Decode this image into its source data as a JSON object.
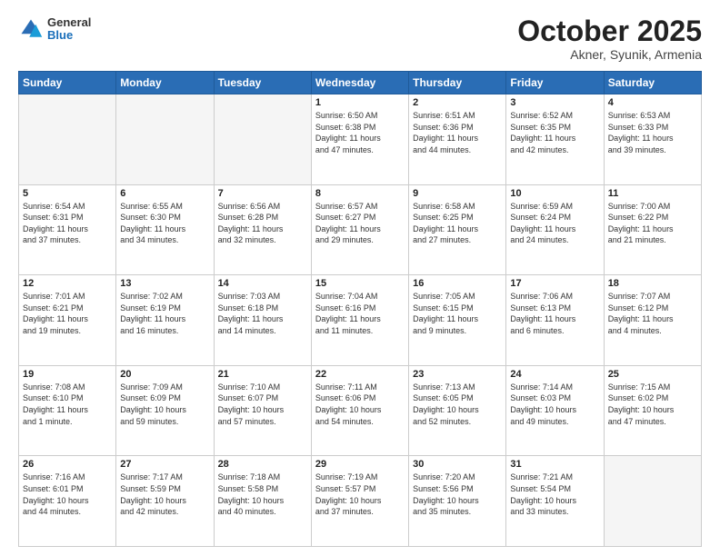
{
  "header": {
    "logo": {
      "general": "General",
      "blue": "Blue"
    },
    "title": "October 2025",
    "location": "Akner, Syunik, Armenia"
  },
  "weekdays": [
    "Sunday",
    "Monday",
    "Tuesday",
    "Wednesday",
    "Thursday",
    "Friday",
    "Saturday"
  ],
  "weeks": [
    [
      {
        "day": "",
        "info": ""
      },
      {
        "day": "",
        "info": ""
      },
      {
        "day": "",
        "info": ""
      },
      {
        "day": "1",
        "info": "Sunrise: 6:50 AM\nSunset: 6:38 PM\nDaylight: 11 hours\nand 47 minutes."
      },
      {
        "day": "2",
        "info": "Sunrise: 6:51 AM\nSunset: 6:36 PM\nDaylight: 11 hours\nand 44 minutes."
      },
      {
        "day": "3",
        "info": "Sunrise: 6:52 AM\nSunset: 6:35 PM\nDaylight: 11 hours\nand 42 minutes."
      },
      {
        "day": "4",
        "info": "Sunrise: 6:53 AM\nSunset: 6:33 PM\nDaylight: 11 hours\nand 39 minutes."
      }
    ],
    [
      {
        "day": "5",
        "info": "Sunrise: 6:54 AM\nSunset: 6:31 PM\nDaylight: 11 hours\nand 37 minutes."
      },
      {
        "day": "6",
        "info": "Sunrise: 6:55 AM\nSunset: 6:30 PM\nDaylight: 11 hours\nand 34 minutes."
      },
      {
        "day": "7",
        "info": "Sunrise: 6:56 AM\nSunset: 6:28 PM\nDaylight: 11 hours\nand 32 minutes."
      },
      {
        "day": "8",
        "info": "Sunrise: 6:57 AM\nSunset: 6:27 PM\nDaylight: 11 hours\nand 29 minutes."
      },
      {
        "day": "9",
        "info": "Sunrise: 6:58 AM\nSunset: 6:25 PM\nDaylight: 11 hours\nand 27 minutes."
      },
      {
        "day": "10",
        "info": "Sunrise: 6:59 AM\nSunset: 6:24 PM\nDaylight: 11 hours\nand 24 minutes."
      },
      {
        "day": "11",
        "info": "Sunrise: 7:00 AM\nSunset: 6:22 PM\nDaylight: 11 hours\nand 21 minutes."
      }
    ],
    [
      {
        "day": "12",
        "info": "Sunrise: 7:01 AM\nSunset: 6:21 PM\nDaylight: 11 hours\nand 19 minutes."
      },
      {
        "day": "13",
        "info": "Sunrise: 7:02 AM\nSunset: 6:19 PM\nDaylight: 11 hours\nand 16 minutes."
      },
      {
        "day": "14",
        "info": "Sunrise: 7:03 AM\nSunset: 6:18 PM\nDaylight: 11 hours\nand 14 minutes."
      },
      {
        "day": "15",
        "info": "Sunrise: 7:04 AM\nSunset: 6:16 PM\nDaylight: 11 hours\nand 11 minutes."
      },
      {
        "day": "16",
        "info": "Sunrise: 7:05 AM\nSunset: 6:15 PM\nDaylight: 11 hours\nand 9 minutes."
      },
      {
        "day": "17",
        "info": "Sunrise: 7:06 AM\nSunset: 6:13 PM\nDaylight: 11 hours\nand 6 minutes."
      },
      {
        "day": "18",
        "info": "Sunrise: 7:07 AM\nSunset: 6:12 PM\nDaylight: 11 hours\nand 4 minutes."
      }
    ],
    [
      {
        "day": "19",
        "info": "Sunrise: 7:08 AM\nSunset: 6:10 PM\nDaylight: 11 hours\nand 1 minute."
      },
      {
        "day": "20",
        "info": "Sunrise: 7:09 AM\nSunset: 6:09 PM\nDaylight: 10 hours\nand 59 minutes."
      },
      {
        "day": "21",
        "info": "Sunrise: 7:10 AM\nSunset: 6:07 PM\nDaylight: 10 hours\nand 57 minutes."
      },
      {
        "day": "22",
        "info": "Sunrise: 7:11 AM\nSunset: 6:06 PM\nDaylight: 10 hours\nand 54 minutes."
      },
      {
        "day": "23",
        "info": "Sunrise: 7:13 AM\nSunset: 6:05 PM\nDaylight: 10 hours\nand 52 minutes."
      },
      {
        "day": "24",
        "info": "Sunrise: 7:14 AM\nSunset: 6:03 PM\nDaylight: 10 hours\nand 49 minutes."
      },
      {
        "day": "25",
        "info": "Sunrise: 7:15 AM\nSunset: 6:02 PM\nDaylight: 10 hours\nand 47 minutes."
      }
    ],
    [
      {
        "day": "26",
        "info": "Sunrise: 7:16 AM\nSunset: 6:01 PM\nDaylight: 10 hours\nand 44 minutes."
      },
      {
        "day": "27",
        "info": "Sunrise: 7:17 AM\nSunset: 5:59 PM\nDaylight: 10 hours\nand 42 minutes."
      },
      {
        "day": "28",
        "info": "Sunrise: 7:18 AM\nSunset: 5:58 PM\nDaylight: 10 hours\nand 40 minutes."
      },
      {
        "day": "29",
        "info": "Sunrise: 7:19 AM\nSunset: 5:57 PM\nDaylight: 10 hours\nand 37 minutes."
      },
      {
        "day": "30",
        "info": "Sunrise: 7:20 AM\nSunset: 5:56 PM\nDaylight: 10 hours\nand 35 minutes."
      },
      {
        "day": "31",
        "info": "Sunrise: 7:21 AM\nSunset: 5:54 PM\nDaylight: 10 hours\nand 33 minutes."
      },
      {
        "day": "",
        "info": ""
      }
    ]
  ]
}
